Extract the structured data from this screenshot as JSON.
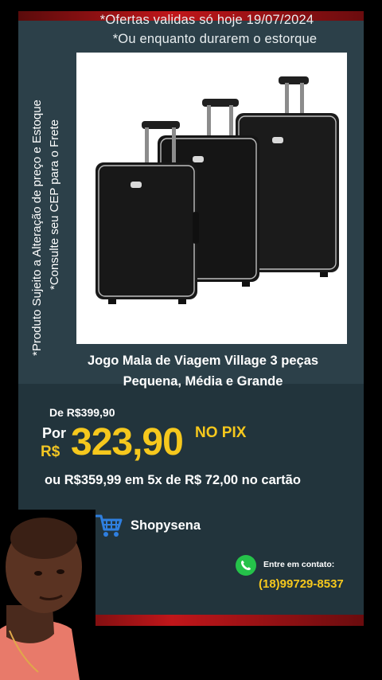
{
  "header": {
    "offer_line": "*Ofertas validas só hoje  19/07/2024",
    "stock_line": "*Ou enquanto durarem o estorque"
  },
  "side_notes": {
    "line1": "*Produto Sujeito a Alteração de preço e Estoque",
    "line2": "*Consulte seu CEP para o Frete"
  },
  "product": {
    "title_line1": "Jogo Mala de Viagem Village 3 peças",
    "title_line2": "Pequena, Média e Grande",
    "image_icon": "luggage-set-photo"
  },
  "pricing": {
    "old_price": "De R$399,90",
    "por_label": "Por",
    "currency": "R$",
    "price": "323,90",
    "pix_label": "NO PIX",
    "installments": "ou R$359,99 em 5x de R$ 72,00 no cartão"
  },
  "store": {
    "icon": "shopping-cart-icon",
    "name": "Shopysena"
  },
  "contact": {
    "icon": "whatsapp-icon",
    "label": "Entre em contato:",
    "phone": "(18)99729-8537"
  },
  "colors": {
    "background": "#22343c",
    "accent_red": "#c0161a",
    "price_yellow": "#f6c81d",
    "whatsapp_green": "#25c24a",
    "cart_blue": "#2f7fe0"
  }
}
